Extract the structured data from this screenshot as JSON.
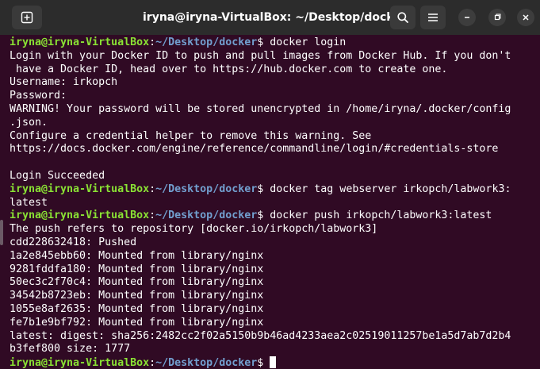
{
  "window": {
    "title": "iryna@iryna-VirtualBox: ~/Desktop/docker"
  },
  "prompt": {
    "user_host": "iryna@iryna-VirtualBox",
    "colon": ":",
    "path": "~/Desktop/docker",
    "dollar": "$ "
  },
  "terminal": {
    "lines": [
      {
        "type": "prompt",
        "cmd": "docker login"
      },
      {
        "type": "output",
        "text": "Login with your Docker ID to push and pull images from Docker Hub. If you don't"
      },
      {
        "type": "output",
        "text": " have a Docker ID, head over to https://hub.docker.com to create one."
      },
      {
        "type": "output",
        "text": "Username: irkopch"
      },
      {
        "type": "output",
        "text": "Password:"
      },
      {
        "type": "output",
        "text": "WARNING! Your password will be stored unencrypted in /home/iryna/.docker/config"
      },
      {
        "type": "output",
        "text": ".json."
      },
      {
        "type": "output",
        "text": "Configure a credential helper to remove this warning. See"
      },
      {
        "type": "output",
        "text": "https://docs.docker.com/engine/reference/commandline/login/#credentials-store"
      },
      {
        "type": "output",
        "text": ""
      },
      {
        "type": "output",
        "text": "Login Succeeded"
      },
      {
        "type": "prompt",
        "cmd": "docker tag webserver irkopch/labwork3:"
      },
      {
        "type": "output",
        "text": "latest"
      },
      {
        "type": "prompt",
        "cmd": "docker push irkopch/labwork3:latest"
      },
      {
        "type": "output",
        "text": "The push refers to repository [docker.io/irkopch/labwork3]"
      },
      {
        "type": "output",
        "text": "cdd228632418: Pushed"
      },
      {
        "type": "output",
        "text": "1a2e845ebb60: Mounted from library/nginx"
      },
      {
        "type": "output",
        "text": "9281fddfa180: Mounted from library/nginx"
      },
      {
        "type": "output",
        "text": "50ec3c2f70c4: Mounted from library/nginx"
      },
      {
        "type": "output",
        "text": "34542b8723eb: Mounted from library/nginx"
      },
      {
        "type": "output",
        "text": "1055e8af2635: Mounted from library/nginx"
      },
      {
        "type": "output",
        "text": "fe7b1e9bf792: Mounted from library/nginx"
      },
      {
        "type": "output",
        "text": "latest: digest: sha256:2482cc2f02a5150b9b46ad4233aea2c02519011257be1a5d7ab7d2b4"
      },
      {
        "type": "output",
        "text": "b3fef800 size: 1777"
      },
      {
        "type": "prompt",
        "cmd": "",
        "cursor": true
      }
    ]
  },
  "icons": {
    "new_tab": "new-tab-icon",
    "search": "search-icon",
    "menu": "hamburger-menu-icon",
    "minimize": "minimize-icon",
    "maximize": "maximize-icon",
    "close": "close-icon"
  },
  "colors": {
    "background": "#300a24",
    "titlebar": "#2c2c2c",
    "prompt_user": "#8ae234",
    "prompt_path": "#729fcf",
    "text": "#ffffff"
  }
}
